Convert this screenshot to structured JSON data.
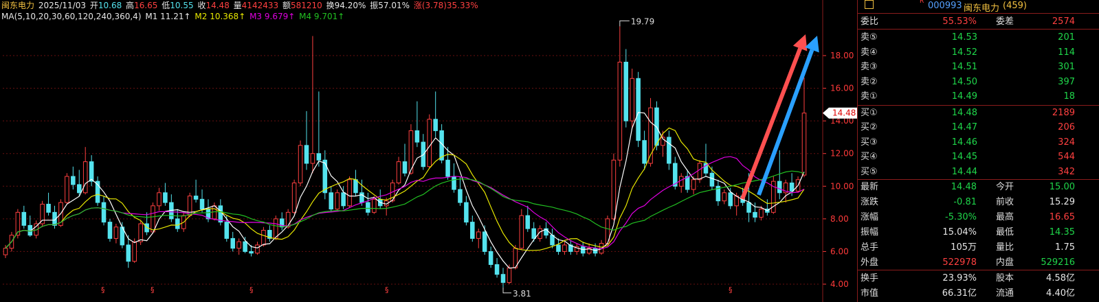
{
  "colors": {
    "up": "#ff4040",
    "down": "#54e3ee",
    "ma1": "#ffffff",
    "ma2": "#e8e800",
    "ma3": "#e000e0",
    "ma4": "#22c022",
    "grid": "#6a1010",
    "axis_text": "#ff3a3a",
    "arrow_red": "#ff5050",
    "arrow_blue": "#2aa0ff"
  },
  "header": {
    "name": "闽东电力",
    "date": "2025/11/03",
    "open_label": "开",
    "open_value": "10.68",
    "high_label": "高",
    "high_value": "16.65",
    "low_label": "低",
    "low_value": "10.55",
    "close_label": "收",
    "close_value": "14.48",
    "vol_label": "量",
    "vol_value": "4142433",
    "amount_label": "额",
    "amount_value": "581210",
    "turnover_label": "换",
    "turnover_value": "94.20%",
    "amplitude_label": "振",
    "amplitude_value": "57.01%",
    "change_label": "涨",
    "change_value": "(3.78)35.33%",
    "ma_params": "MA(5,10,20,30,60,120,240,360,4)",
    "m1": "M1 11.21",
    "m2": "M2 10.368",
    "m3": "M3 9.679",
    "m4": "M4 9.701",
    "up_arrow": "↑"
  },
  "chart_data": {
    "type": "candlestick",
    "y_ticks": [
      "4.00",
      "6.00",
      "8.00",
      "10.00",
      "12.00",
      "14.00",
      "16.00",
      "18.00"
    ],
    "ylim": [
      3.5,
      20.5
    ],
    "current_price": "14.48",
    "annotations": {
      "high": "19.79",
      "low": "3.81"
    },
    "event_marker": "§",
    "candles": [
      [
        5.8,
        6.4,
        5.6,
        6.2
      ],
      [
        6.2,
        7.2,
        6.0,
        7.0
      ],
      [
        7.0,
        8.6,
        6.8,
        8.4
      ],
      [
        8.4,
        8.8,
        7.4,
        7.6
      ],
      [
        7.6,
        8.2,
        6.9,
        7.0
      ],
      [
        7.0,
        7.9,
        6.8,
        7.7
      ],
      [
        7.7,
        9.1,
        7.5,
        8.9
      ],
      [
        8.9,
        9.6,
        8.2,
        8.4
      ],
      [
        8.4,
        8.8,
        7.4,
        7.6
      ],
      [
        7.6,
        9.2,
        7.5,
        9.0
      ],
      [
        9.0,
        10.8,
        8.9,
        10.6
      ],
      [
        10.6,
        11.2,
        9.8,
        10.1
      ],
      [
        10.1,
        11.0,
        9.4,
        9.6
      ],
      [
        9.6,
        12.4,
        9.5,
        11.5
      ],
      [
        11.5,
        11.9,
        10.0,
        10.3
      ],
      [
        10.3,
        10.6,
        8.8,
        9.0
      ],
      [
        9.0,
        9.4,
        7.6,
        7.8
      ],
      [
        7.8,
        8.0,
        6.6,
        6.8
      ],
      [
        6.8,
        7.7,
        6.5,
        7.5
      ],
      [
        7.5,
        7.8,
        6.2,
        6.4
      ],
      [
        6.4,
        7.0,
        5.0,
        5.4
      ],
      [
        5.4,
        6.8,
        5.3,
        6.6
      ],
      [
        6.6,
        7.9,
        6.4,
        7.7
      ],
      [
        7.7,
        8.4,
        7.0,
        7.2
      ],
      [
        7.2,
        9.0,
        7.1,
        8.8
      ],
      [
        8.8,
        9.9,
        8.5,
        9.6
      ],
      [
        9.6,
        10.2,
        8.8,
        9.0
      ],
      [
        9.0,
        9.5,
        7.8,
        8.0
      ],
      [
        8.0,
        8.6,
        7.2,
        7.4
      ],
      [
        7.4,
        8.4,
        7.2,
        8.2
      ],
      [
        8.2,
        9.6,
        8.1,
        9.4
      ],
      [
        9.4,
        10.4,
        9.0,
        9.2
      ],
      [
        9.2,
        9.8,
        8.4,
        8.6
      ],
      [
        8.6,
        9.2,
        7.8,
        8.0
      ],
      [
        8.0,
        9.0,
        7.9,
        8.8
      ],
      [
        8.8,
        9.2,
        7.6,
        7.8
      ],
      [
        7.8,
        8.2,
        6.6,
        6.8
      ],
      [
        6.8,
        7.2,
        6.0,
        6.2
      ],
      [
        6.2,
        6.8,
        5.8,
        6.6
      ],
      [
        6.6,
        6.9,
        5.9,
        6.0
      ],
      [
        6.0,
        6.4,
        5.7,
        5.9
      ],
      [
        5.9,
        6.6,
        5.8,
        6.4
      ],
      [
        6.4,
        7.5,
        6.3,
        7.3
      ],
      [
        7.3,
        7.6,
        6.6,
        6.8
      ],
      [
        6.8,
        8.2,
        6.7,
        8.0
      ],
      [
        8.0,
        8.4,
        7.3,
        7.5
      ],
      [
        7.5,
        8.6,
        7.4,
        8.4
      ],
      [
        8.4,
        10.4,
        8.3,
        10.2
      ],
      [
        10.2,
        12.8,
        10.0,
        12.5
      ],
      [
        12.5,
        14.6,
        11.0,
        11.4
      ],
      [
        11.4,
        19.2,
        10.8,
        12.0
      ],
      [
        12.0,
        15.8,
        11.2,
        11.6
      ],
      [
        11.6,
        12.2,
        9.2,
        9.6
      ],
      [
        9.6,
        10.0,
        8.4,
        8.6
      ],
      [
        8.6,
        9.8,
        8.5,
        9.6
      ],
      [
        9.6,
        10.0,
        8.6,
        8.8
      ],
      [
        8.8,
        10.6,
        8.7,
        10.4
      ],
      [
        10.4,
        11.0,
        9.4,
        9.6
      ],
      [
        9.6,
        10.4,
        8.8,
        9.0
      ],
      [
        9.0,
        9.6,
        8.2,
        8.4
      ],
      [
        8.4,
        9.4,
        8.3,
        9.2
      ],
      [
        9.2,
        9.8,
        8.6,
        8.8
      ],
      [
        8.8,
        9.3,
        8.2,
        9.1
      ],
      [
        9.1,
        10.4,
        9.0,
        10.2
      ],
      [
        10.2,
        11.8,
        10.1,
        11.5
      ],
      [
        11.5,
        12.6,
        10.6,
        10.8
      ],
      [
        10.8,
        13.8,
        10.7,
        13.4
      ],
      [
        13.4,
        15.2,
        12.4,
        12.7
      ],
      [
        12.7,
        13.2,
        11.0,
        11.2
      ],
      [
        11.2,
        14.4,
        11.1,
        14.1
      ],
      [
        14.1,
        15.8,
        13.0,
        13.4
      ],
      [
        13.4,
        13.8,
        11.4,
        11.6
      ],
      [
        11.6,
        12.4,
        10.4,
        10.6
      ],
      [
        10.6,
        11.4,
        9.6,
        9.8
      ],
      [
        9.8,
        10.6,
        8.8,
        9.0
      ],
      [
        9.0,
        9.4,
        7.6,
        7.8
      ],
      [
        7.8,
        8.2,
        6.6,
        6.8
      ],
      [
        6.8,
        7.4,
        6.2,
        7.2
      ],
      [
        7.2,
        7.6,
        5.8,
        6.0
      ],
      [
        6.0,
        6.3,
        5.0,
        5.2
      ],
      [
        5.2,
        5.6,
        4.4,
        4.6
      ],
      [
        4.6,
        5.0,
        3.8,
        4.1
      ],
      [
        4.1,
        5.2,
        4.0,
        5.0
      ],
      [
        5.0,
        6.4,
        4.9,
        6.2
      ],
      [
        6.2,
        8.6,
        6.1,
        8.2
      ],
      [
        8.2,
        8.8,
        7.2,
        7.4
      ],
      [
        7.4,
        7.8,
        6.6,
        6.8
      ],
      [
        6.8,
        7.6,
        6.6,
        7.4
      ],
      [
        7.4,
        7.8,
        6.8,
        7.0
      ],
      [
        7.0,
        7.4,
        6.2,
        6.4
      ],
      [
        6.4,
        6.8,
        5.8,
        6.0
      ],
      [
        6.0,
        6.6,
        5.8,
        6.4
      ],
      [
        6.4,
        6.7,
        5.8,
        6.0
      ],
      [
        6.0,
        6.5,
        5.8,
        6.3
      ],
      [
        6.3,
        6.6,
        5.7,
        5.9
      ],
      [
        5.9,
        6.5,
        5.8,
        6.2
      ],
      [
        6.2,
        6.5,
        5.7,
        5.9
      ],
      [
        5.9,
        6.7,
        5.8,
        6.5
      ],
      [
        6.5,
        8.2,
        6.4,
        8.0
      ],
      [
        8.0,
        12.0,
        7.9,
        11.6
      ],
      [
        11.6,
        19.79,
        11.2,
        17.6
      ],
      [
        17.6,
        18.4,
        13.6,
        14.0
      ],
      [
        14.0,
        17.2,
        13.6,
        16.6
      ],
      [
        16.6,
        17.0,
        12.4,
        12.8
      ],
      [
        12.8,
        13.4,
        11.0,
        11.4
      ],
      [
        11.4,
        15.4,
        11.2,
        14.8
      ],
      [
        14.8,
        15.2,
        12.2,
        12.5
      ],
      [
        12.5,
        13.4,
        11.8,
        13.0
      ],
      [
        13.0,
        13.4,
        11.0,
        11.4
      ],
      [
        11.4,
        11.8,
        9.8,
        10.0
      ],
      [
        10.0,
        10.8,
        9.6,
        10.6
      ],
      [
        10.6,
        11.0,
        9.6,
        9.8
      ],
      [
        9.8,
        10.6,
        9.5,
        10.4
      ],
      [
        10.4,
        11.6,
        10.2,
        11.4
      ],
      [
        11.4,
        12.6,
        10.6,
        10.8
      ],
      [
        10.8,
        11.2,
        9.8,
        10.0
      ],
      [
        10.0,
        10.4,
        8.8,
        9.1
      ],
      [
        9.1,
        9.8,
        8.9,
        9.6
      ],
      [
        9.6,
        9.9,
        8.6,
        8.8
      ],
      [
        8.8,
        9.6,
        8.2,
        9.4
      ],
      [
        9.4,
        9.9,
        8.8,
        9.0
      ],
      [
        9.0,
        10.8,
        7.8,
        8.4
      ],
      [
        8.4,
        9.0,
        7.8,
        8.1
      ],
      [
        8.1,
        8.8,
        7.9,
        8.6
      ],
      [
        8.6,
        9.2,
        8.2,
        8.4
      ],
      [
        8.4,
        10.6,
        8.3,
        10.3
      ],
      [
        10.3,
        12.2,
        9.2,
        9.6
      ],
      [
        9.6,
        10.4,
        9.0,
        10.2
      ],
      [
        10.2,
        10.8,
        9.4,
        9.7
      ],
      [
        9.7,
        10.6,
        9.6,
        10.4
      ],
      [
        10.68,
        16.65,
        10.55,
        14.48
      ]
    ],
    "ma_series": [
      {
        "name": "M1",
        "color_key": "ma1",
        "period": 5
      },
      {
        "name": "M2",
        "color_key": "ma2",
        "period": 10
      },
      {
        "name": "M3",
        "color_key": "ma3",
        "period": 20
      },
      {
        "name": "M4",
        "color_key": "ma4",
        "period": 30
      }
    ],
    "trend_arrows": 2
  },
  "quote": {
    "code_marker": "R",
    "code": "000993",
    "name": "闽东电力",
    "extra": "(459)",
    "weibi_label": "委比",
    "weibi_value": "55.53%",
    "weicha_label": "委差",
    "weicha_value": "2574",
    "asks": [
      {
        "label": "卖⑤",
        "price": "14.53",
        "vol": "201"
      },
      {
        "label": "卖④",
        "price": "14.52",
        "vol": "114"
      },
      {
        "label": "卖③",
        "price": "14.51",
        "vol": "301"
      },
      {
        "label": "卖②",
        "price": "14.50",
        "vol": "397"
      },
      {
        "label": "卖①",
        "price": "14.49",
        "vol": "18"
      }
    ],
    "bids": [
      {
        "label": "买①",
        "price": "14.48",
        "vol": "2189"
      },
      {
        "label": "买②",
        "price": "14.47",
        "vol": "206"
      },
      {
        "label": "买③",
        "price": "14.46",
        "vol": "324"
      },
      {
        "label": "买④",
        "price": "14.45",
        "vol": "544"
      },
      {
        "label": "买⑤",
        "price": "14.44",
        "vol": "342"
      }
    ],
    "stats": [
      {
        "l1": "最新",
        "v1": "14.48",
        "c1": "green",
        "l2": "今开",
        "v2": "15.00",
        "c2": "green"
      },
      {
        "l1": "涨跌",
        "v1": "-0.81",
        "c1": "green",
        "l2": "前收",
        "v2": "15.29",
        "c2": "white"
      },
      {
        "l1": "涨幅",
        "v1": "-5.30%",
        "c1": "green",
        "l2": "最高",
        "v2": "16.65",
        "c2": "red"
      },
      {
        "l1": "振幅",
        "v1": "15.04%",
        "c1": "white",
        "l2": "最低",
        "v2": "14.35",
        "c2": "green"
      },
      {
        "l1": "总手",
        "v1": "105万",
        "c1": "white",
        "l2": "量比",
        "v2": "1.75",
        "c2": "white"
      },
      {
        "l1": "外盘",
        "v1": "522978",
        "c1": "red",
        "l2": "内盘",
        "v2": "529216",
        "c2": "green"
      },
      {
        "l1": "换手",
        "v1": "23.93%",
        "c1": "white",
        "l2": "股本",
        "v2": "4.58亿",
        "c2": "white"
      },
      {
        "l1": "市值",
        "v1": "66.31亿",
        "c1": "white",
        "l2": "流通",
        "v2": "4.40亿",
        "c2": "white"
      }
    ]
  }
}
